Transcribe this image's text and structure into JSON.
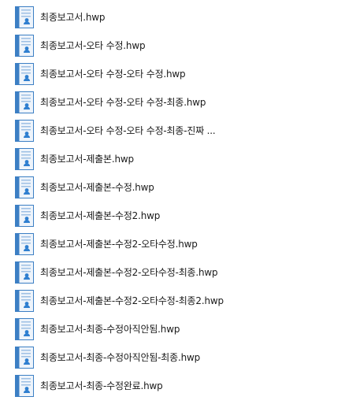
{
  "file_list": {
    "items": [
      {
        "name": "최종보고서.hwp",
        "icon": "hwp-document-icon"
      },
      {
        "name": "최종보고서-오타 수정.hwp",
        "icon": "hwp-document-icon"
      },
      {
        "name": "최종보고서-오타 수정-오타 수정.hwp",
        "icon": "hwp-document-icon"
      },
      {
        "name": "최종보고서-오타 수정-오타 수정-최종.hwp",
        "icon": "hwp-document-icon"
      },
      {
        "name": "최종보고서-오타 수정-오타 수정-최종-진짜 ...",
        "icon": "hwp-document-icon"
      },
      {
        "name": "최종보고서-제출본.hwp",
        "icon": "hwp-document-icon"
      },
      {
        "name": "최종보고서-제출본-수정.hwp",
        "icon": "hwp-document-icon"
      },
      {
        "name": "최종보고서-제출본-수정2.hwp",
        "icon": "hwp-document-icon"
      },
      {
        "name": "최종보고서-제출본-수정2-오타수정.hwp",
        "icon": "hwp-document-icon"
      },
      {
        "name": "최종보고서-제출본-수정2-오타수정-최종.hwp",
        "icon": "hwp-document-icon"
      },
      {
        "name": "최종보고서-제출본-수정2-오타수정-최종2.hwp",
        "icon": "hwp-document-icon"
      },
      {
        "name": "최종보고서-최종-수정아직안됨.hwp",
        "icon": "hwp-document-icon"
      },
      {
        "name": "최종보고서-최종-수정아직안됨-최종.hwp",
        "icon": "hwp-document-icon"
      },
      {
        "name": "최종보고서-최종-수정완료.hwp",
        "icon": "hwp-document-icon"
      }
    ]
  },
  "colors": {
    "icon_blue": "#2f7fd0",
    "icon_frame": "#3c7fc4",
    "icon_page": "#eef4fb",
    "text": "#1a1a1a"
  }
}
